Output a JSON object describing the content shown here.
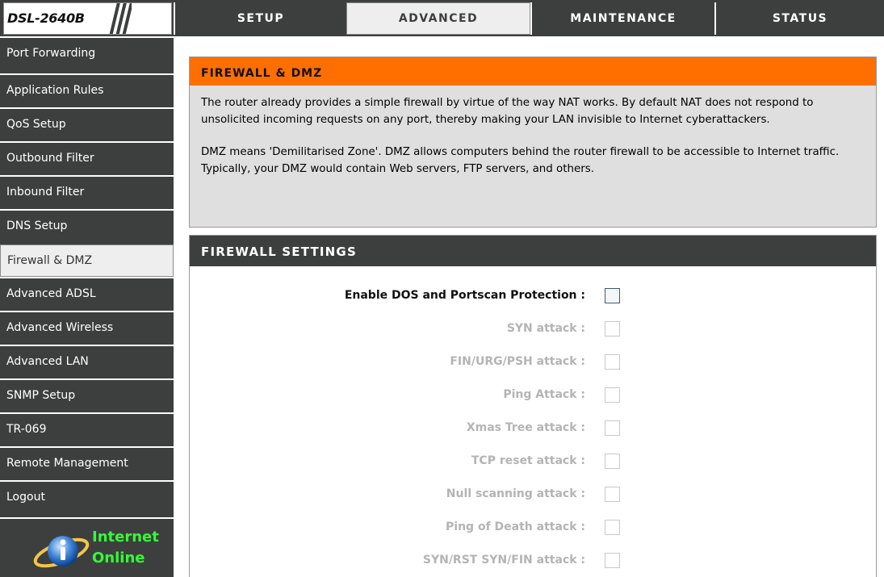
{
  "header": {
    "logo_text": "DSL-2640B",
    "tabs": [
      {
        "label": "SETUP",
        "active": false
      },
      {
        "label": "ADVANCED",
        "active": true
      },
      {
        "label": "MAINTENANCE",
        "active": false
      },
      {
        "label": "STATUS",
        "active": false
      }
    ]
  },
  "sidebar": {
    "items": [
      {
        "label": "Port Forwarding"
      },
      {
        "label": "Application Rules"
      },
      {
        "label": "QoS Setup"
      },
      {
        "label": "Outbound Filter"
      },
      {
        "label": "Inbound Filter"
      },
      {
        "label": "DNS Setup"
      },
      {
        "label": "Firewall & DMZ",
        "active": true
      },
      {
        "label": "Advanced ADSL"
      },
      {
        "label": "Advanced Wireless"
      },
      {
        "label": "Advanced LAN"
      },
      {
        "label": "SNMP Setup"
      },
      {
        "label": "TR-069"
      },
      {
        "label": "Remote Management"
      },
      {
        "label": "Logout"
      }
    ],
    "status": {
      "line1": "Internet",
      "line2": "Online",
      "icon": "globe-info-icon"
    }
  },
  "intro": {
    "title": "FIREWALL & DMZ",
    "paragraph1": "The router already provides a simple firewall by virtue of the way NAT works. By default NAT does not respond to unsolicited incoming requests on any port, thereby making your LAN invisible to Internet cyberattackers.",
    "paragraph2": "DMZ means 'Demilitarised Zone'. DMZ allows computers behind the router firewall to be accessible to Internet traffic. Typically, your DMZ would contain Web servers, FTP servers, and others."
  },
  "settings": {
    "title": "FIREWALL SETTINGS",
    "rows": [
      {
        "label": "Enable DOS and Portscan Protection :",
        "enabled": true,
        "checked": false
      },
      {
        "label": "SYN attack :",
        "enabled": false,
        "checked": false
      },
      {
        "label": "FIN/URG/PSH attack :",
        "enabled": false,
        "checked": false
      },
      {
        "label": "Ping Attack :",
        "enabled": false,
        "checked": false
      },
      {
        "label": "Xmas Tree attack :",
        "enabled": false,
        "checked": false
      },
      {
        "label": "TCP reset attack :",
        "enabled": false,
        "checked": false
      },
      {
        "label": "Null scanning attack :",
        "enabled": false,
        "checked": false
      },
      {
        "label": "Ping of Death attack :",
        "enabled": false,
        "checked": false
      },
      {
        "label": "SYN/RST SYN/FIN attack :",
        "enabled": false,
        "checked": false
      }
    ]
  },
  "colors": {
    "header_bg": "#3d3f3f",
    "accent_orange": "#ff6f00",
    "online_green": "#33ff33"
  }
}
